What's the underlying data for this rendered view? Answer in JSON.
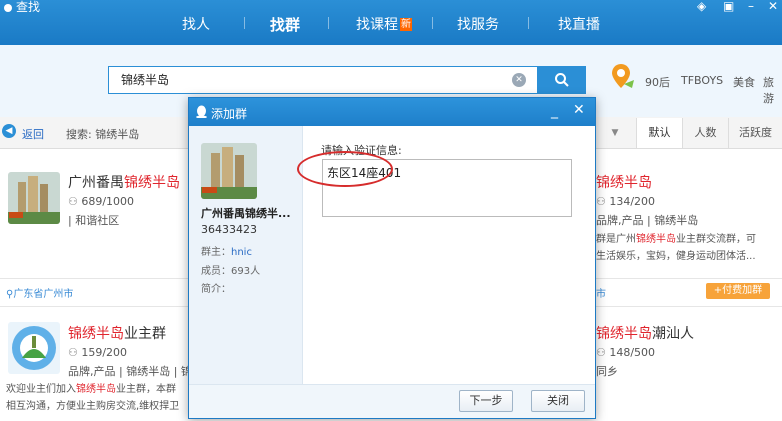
{
  "app": {
    "title": "查找"
  },
  "nav": {
    "tabs": [
      {
        "label": "找人"
      },
      {
        "label": "找群"
      },
      {
        "label": "找课程",
        "badge": "新"
      },
      {
        "label": "找服务"
      },
      {
        "label": "找直播"
      }
    ]
  },
  "search": {
    "value": "锦绣半岛",
    "hot_tags": [
      "90后",
      "TFBOYS",
      "美食",
      "旅游"
    ]
  },
  "toolbar": {
    "back_label": "返回",
    "crumb": "搜索: 锦绣半岛",
    "sort_tabs": [
      "默认",
      "人数",
      "活跃度"
    ]
  },
  "results": [
    {
      "name_hl": "锦绣半岛",
      "name_prefix": "广州番禺",
      "name_suffix": "",
      "members": "689/1000",
      "tags": "和谐社区",
      "location": "广东省广州市"
    },
    {
      "name_hl": "锦绣半岛",
      "name_prefix": "",
      "name_suffix": "业主群",
      "members": "159/200",
      "tags": "品牌,产品 | 锦绣半岛 | 锦",
      "desc1_pre": "欢迎业主们加入",
      "desc1_hl": "锦绣半岛",
      "desc1_post": "业主群，本群",
      "desc2": "相互沟通，方便业主购房交流,维权捍卫"
    },
    {
      "name_hl": "锦绣半岛",
      "name_prefix": "",
      "name_suffix": "",
      "members": "134/200",
      "tags": "品牌,产品 | 锦绣半岛",
      "desc1_pre": "群是广州",
      "desc1_hl": "锦绣半岛",
      "desc1_post": "业主群交流群，可",
      "desc2": "生活娱乐，宝妈，健身运动团体活...",
      "location": "市",
      "action": "+付费加群"
    },
    {
      "name_hl": "锦绣半岛",
      "name_prefix": "",
      "name_suffix": "潮汕人",
      "members": "148/500",
      "tags": "同乡"
    }
  ],
  "dialog": {
    "title": "添加群",
    "group_name": "广州番禺锦绣半...",
    "group_id": "36433423",
    "owner_label": "群主：",
    "owner": "hnic",
    "members_label": "成员：",
    "members": "693人",
    "intro_label": "简介：",
    "verify_label": "请输入验证信息:",
    "verify_value": "东区14座401",
    "next_label": "下一步",
    "close_label": "关闭"
  },
  "colors": {
    "brand": "#2b8fd6",
    "highlight": "#e0262e",
    "action": "#f7a33a",
    "annotation": "#d62c2c"
  }
}
